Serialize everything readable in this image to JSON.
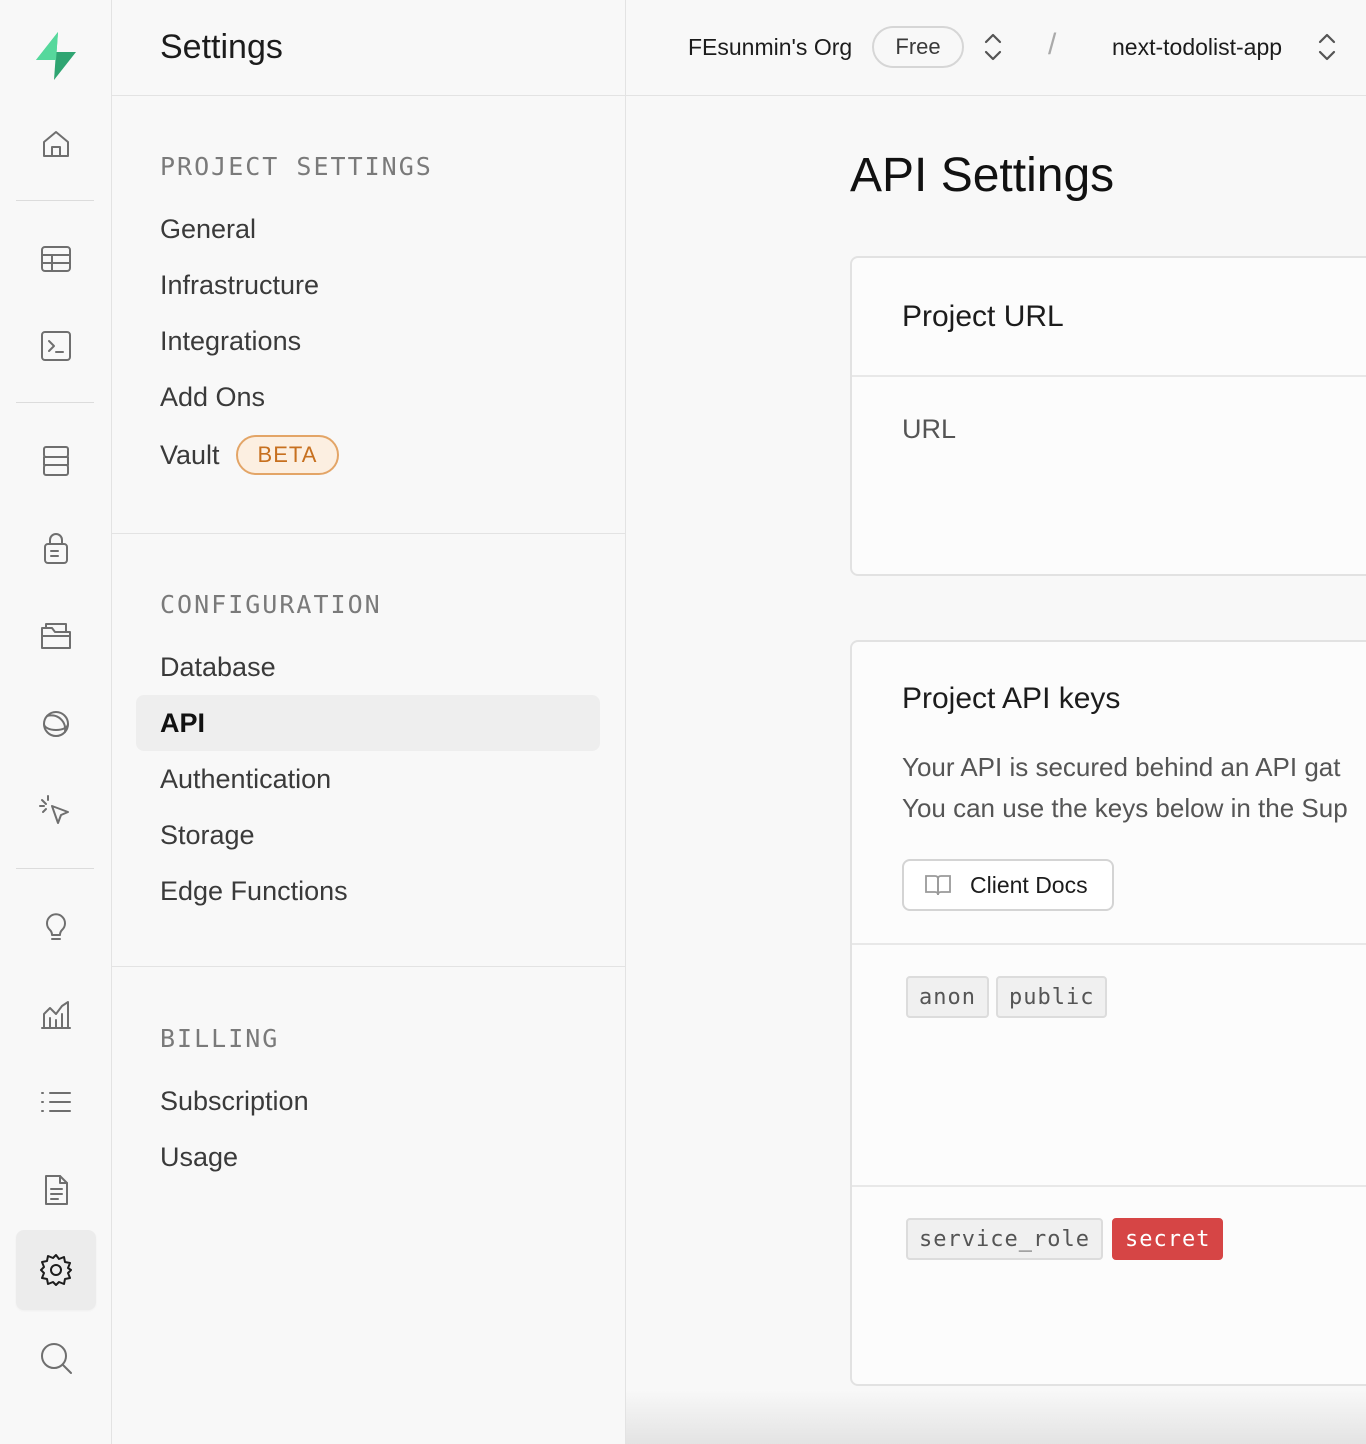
{
  "sidebar_title": "Settings",
  "topbar": {
    "org": "FEsunmin's Org",
    "plan": "Free",
    "separator": "/",
    "project": "next-todolist-app"
  },
  "menu": {
    "project_settings": {
      "title": "PROJECT SETTINGS",
      "items": [
        "General",
        "Infrastructure",
        "Integrations",
        "Add Ons",
        "Vault"
      ],
      "vault_badge": "BETA"
    },
    "configuration": {
      "title": "CONFIGURATION",
      "items": [
        "Database",
        "API",
        "Authentication",
        "Storage",
        "Edge Functions"
      ],
      "active": "API"
    },
    "billing": {
      "title": "BILLING",
      "items": [
        "Subscription",
        "Usage"
      ]
    }
  },
  "main": {
    "title": "API Settings",
    "project_url": {
      "title": "Project URL",
      "field_label": "URL"
    },
    "api_keys": {
      "title": "Project API keys",
      "desc_line1": "Your API is secured behind an API gat",
      "desc_line2": "You can use the keys below in the Sup",
      "docs_button": "Client Docs",
      "anon_key": {
        "tags": [
          "anon",
          "public"
        ]
      },
      "service_key": {
        "tags": [
          "service_role",
          "secret"
        ]
      }
    }
  },
  "colors": {
    "brand": "#3ecf8e",
    "beta_text": "#c7701f",
    "secret_badge": "#d64545"
  },
  "icons": [
    "home-icon",
    "table-editor-icon",
    "sql-editor-icon",
    "database-icon",
    "authentication-icon",
    "storage-icon",
    "realtime-icon",
    "edge-functions-icon",
    "advisors-icon",
    "reports-icon",
    "logs-icon",
    "api-docs-icon",
    "settings-icon",
    "search-icon"
  ]
}
